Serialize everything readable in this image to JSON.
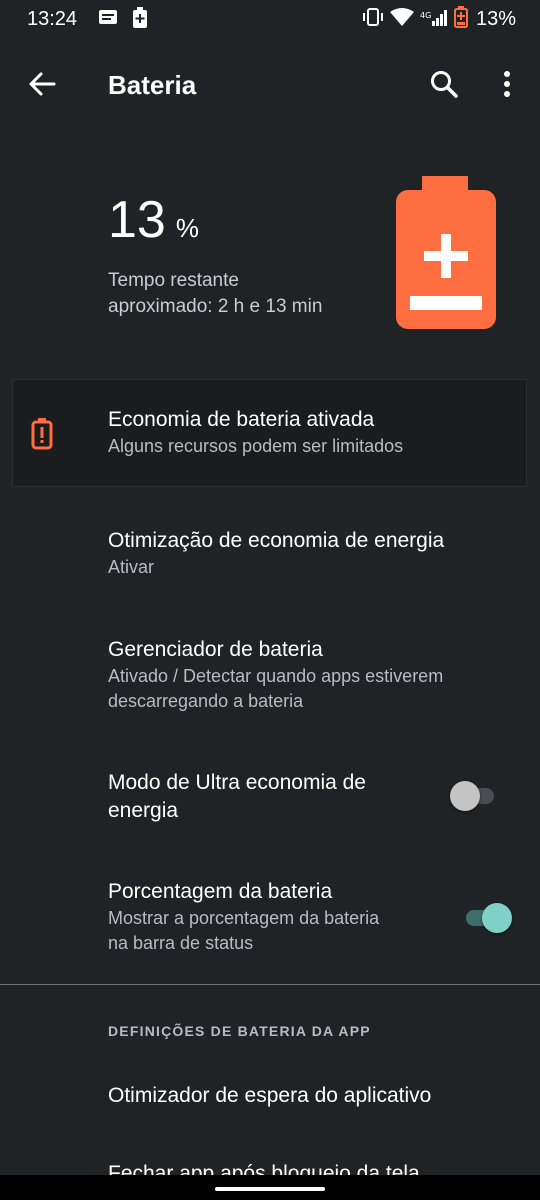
{
  "status_bar": {
    "time": "13:24",
    "battery_percent": "13%",
    "network": "4G"
  },
  "app_bar": {
    "title": "Bateria"
  },
  "battery": {
    "level": "13",
    "unit": "%",
    "remaining_line1": "Tempo restante",
    "remaining_line2": "aproximado: 2 h e 13 min",
    "accent_color": "#ff6e40"
  },
  "saver": {
    "title": "Economia de bateria ativada",
    "subtitle": "Alguns recursos podem ser limitados"
  },
  "settings": [
    {
      "title": "Otimização de economia de energia",
      "subtitle": "Ativar"
    },
    {
      "title": "Gerenciador de bateria",
      "subtitle": "Ativado / Detectar quando apps estiverem descarregando a bateria"
    },
    {
      "title": "Modo de Ultra economia de energia",
      "toggle": false
    },
    {
      "title": "Porcentagem da bateria",
      "subtitle": "Mostrar a porcentagem da bateria na barra de status",
      "toggle": true
    }
  ],
  "app_section": {
    "header": "DEFINIÇÕES DE BATERIA DA APP",
    "items": [
      {
        "title": "Otimizador de espera do aplicativo"
      },
      {
        "title": "Fechar app após bloqueio da tela"
      }
    ]
  },
  "icons": {
    "back": "arrow-back-icon",
    "search": "search-icon",
    "more": "more-vert-icon",
    "battery_saver": "battery-alert-icon",
    "battery_large": "battery-charging-icon"
  }
}
